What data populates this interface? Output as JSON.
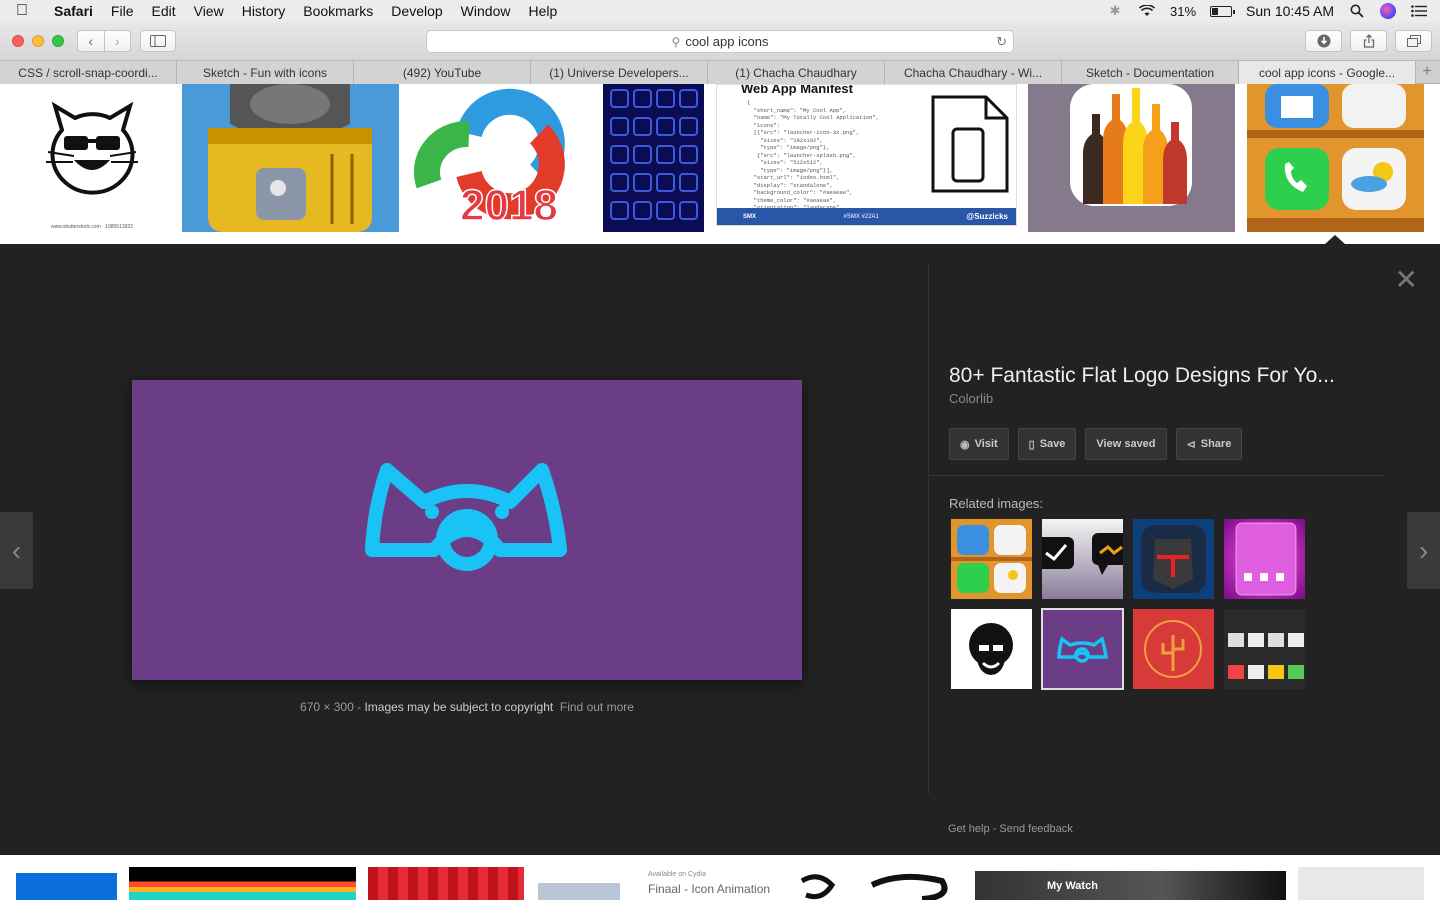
{
  "menubar": {
    "app_name": "Safari",
    "menus": [
      "File",
      "Edit",
      "View",
      "History",
      "Bookmarks",
      "Develop",
      "Window",
      "Help"
    ],
    "battery_percent": "31%",
    "battery_level": 0.31,
    "clock": "Sun 10:45 AM"
  },
  "toolbar": {
    "address_text": "cool app icons"
  },
  "tabs": [
    {
      "label": "CSS / scroll-snap-coordi..."
    },
    {
      "label": "Sketch - Fun with icons"
    },
    {
      "label": "(492) YouTube"
    },
    {
      "label": "(1) Universe Developers..."
    },
    {
      "label": "(1) Chacha Chaudhary"
    },
    {
      "label": "Chacha Chaudhary - Wi..."
    },
    {
      "label": "Sketch - Documentation"
    },
    {
      "label": "cool app icons - Google...",
      "active": true
    }
  ],
  "top_thumbs": {
    "year_text": "2018",
    "manifest_heading": "Web App Manifest",
    "manifest_code": "{\n  \"short_name\": \"My Cool App\",\n  \"name\": \"My Totally Cool Application\",\n  \"icons\":\n  [{\"src\": \"launcher-icon-3x.png\",\n    \"sizes\": \"192x192\",\n    \"type\": \"image/png\"},\n   {\"src\": \"launcher-splash.png\",\n    \"sizes\": \"512x512\",\n    \"type\": \"image/png\"}],\n  \"start_url\": \"index.html\",\n  \"display\": \"standalone\",\n  \"background_color\": \"#aeaeae\",\n  \"theme_color\": \"#aeaeae\",\n  \"orientation\": \"landscape\"",
    "manifest_footer_left": "SMX",
    "manifest_footer_mid": "#SMX #22A1",
    "manifest_footer_right": "@Suzzicks",
    "shutterstock_text": "www.shutterstock.com · 1085513932"
  },
  "viewer": {
    "title": "80+ Fantastic Flat Logo Designs For Yo...",
    "source": "Colorlib",
    "dimensions": "670 × 300",
    "copyright_text": "Images may be subject to copyright",
    "find_out_more": "Find out more",
    "buttons": {
      "visit": "Visit",
      "save": "Save",
      "view_saved": "View saved",
      "share": "Share"
    },
    "related_label": "Related images:",
    "get_help": "Get help",
    "send_feedback": "Send feedback",
    "separator": "-"
  },
  "bottom_thumbs": {
    "cydia_small": "Available on Cydia",
    "cydia_big": "Finaal - Icon Animation",
    "watch_label": "My Watch"
  },
  "colors": {
    "logo_purple": "#6b3d86",
    "logo_cyan": "#19c3f5"
  }
}
